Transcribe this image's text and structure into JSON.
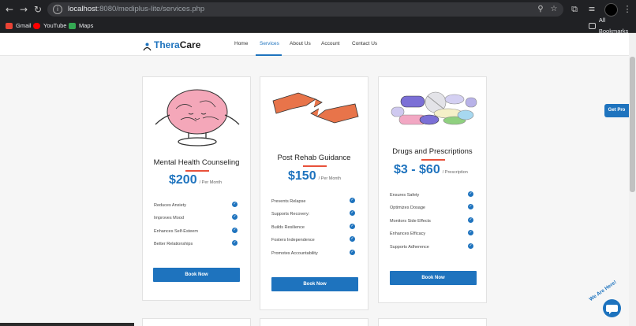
{
  "browser": {
    "url_host": "localhost",
    "url_path": ":8080/mediplus-lite/services.php",
    "bookmarks": [
      {
        "label": "Gmail",
        "icon": "gmail-icon",
        "color": "#ea4335"
      },
      {
        "label": "YouTube",
        "icon": "youtube-icon",
        "color": "#ff0000"
      },
      {
        "label": "Maps",
        "icon": "maps-icon",
        "color": "#34a853"
      }
    ],
    "all_bookmarks": "All Bookmarks"
  },
  "site": {
    "logo_a": "Thera",
    "logo_b": "Care",
    "nav": [
      "Home",
      "Services",
      "About Us",
      "Account",
      "Contact Us"
    ],
    "active_nav": "Services",
    "accent": "#1e73be",
    "divider_color": "#e8513a"
  },
  "cards": [
    {
      "title": "Mental Health Counseling",
      "price": "$200",
      "per": "/ Per Month",
      "features": [
        "Reduces Anxiety",
        "Improves Mood",
        "Enhances Self-Esteem",
        "Better Relationships"
      ],
      "button": "Book Now",
      "image": "brain-meditation-illustration"
    },
    {
      "title": "Post Rehab Guidance",
      "price": "$150",
      "per": "/ Per Month",
      "features": [
        "Prevents Relapse",
        "Supports Recovery:",
        "Builds Resilience",
        "Fosters Independence",
        "Promotes Accountability"
      ],
      "button": "Book Now",
      "image": "helping-hands-illustration"
    },
    {
      "title": "Drugs and Prescriptions",
      "price": "$3 - $60",
      "per": "/ Prescription",
      "features": [
        "Ensures Safety",
        "Optimizes Dosage",
        "Monitors Side Effects",
        "Enhances Efficacy",
        "Supports Adherence"
      ],
      "button": "Book Now",
      "image": "pills-illustration"
    }
  ],
  "widgets": {
    "get_pro": "Get Pro",
    "chat_text": "We Are Here!"
  }
}
